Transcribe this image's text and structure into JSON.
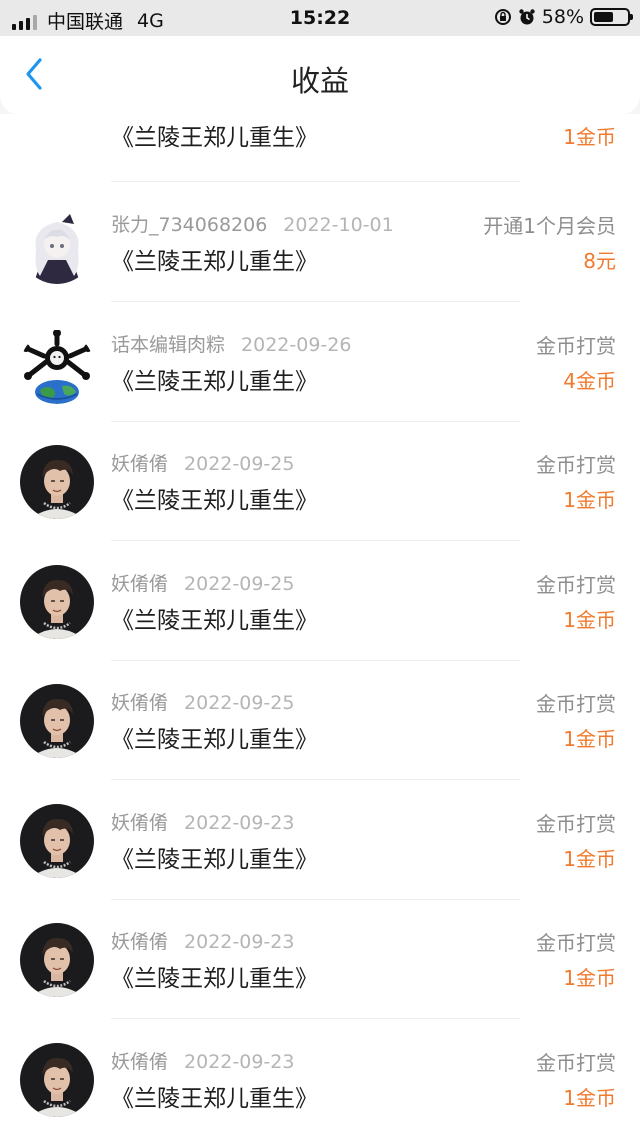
{
  "status_bar": {
    "carrier": "中国联通",
    "network": "4G",
    "time": "15:22",
    "battery": "58%",
    "battery_level": 0.58
  },
  "nav": {
    "title": "收益"
  },
  "colors": {
    "accent": "#f07a2e",
    "back": "#1e96f0"
  },
  "records": [
    {
      "user": "",
      "date": "",
      "title": "《兰陵王郑儿重生》",
      "type": "",
      "amount": "1金币",
      "avatar": "boy-portrait"
    },
    {
      "user": "张力_734068206",
      "date": "2022-10-01",
      "title": "《兰陵王郑儿重生》",
      "type": "开通1个月会员",
      "amount": "8元",
      "avatar": "anime-girl"
    },
    {
      "user": "话本编辑肉粽",
      "date": "2022-09-26",
      "title": "《兰陵王郑儿重生》",
      "type": "金币打赏",
      "amount": "4金币",
      "avatar": "globe-bones"
    },
    {
      "user": "妖倄倄",
      "date": "2022-09-25",
      "title": "《兰陵王郑儿重生》",
      "type": "金币打赏",
      "amount": "1金币",
      "avatar": "boy-portrait"
    },
    {
      "user": "妖倄倄",
      "date": "2022-09-25",
      "title": "《兰陵王郑儿重生》",
      "type": "金币打赏",
      "amount": "1金币",
      "avatar": "boy-portrait"
    },
    {
      "user": "妖倄倄",
      "date": "2022-09-25",
      "title": "《兰陵王郑儿重生》",
      "type": "金币打赏",
      "amount": "1金币",
      "avatar": "boy-portrait"
    },
    {
      "user": "妖倄倄",
      "date": "2022-09-23",
      "title": "《兰陵王郑儿重生》",
      "type": "金币打赏",
      "amount": "1金币",
      "avatar": "boy-portrait"
    },
    {
      "user": "妖倄倄",
      "date": "2022-09-23",
      "title": "《兰陵王郑儿重生》",
      "type": "金币打赏",
      "amount": "1金币",
      "avatar": "boy-portrait"
    },
    {
      "user": "妖倄倄",
      "date": "2022-09-23",
      "title": "《兰陵王郑儿重生》",
      "type": "金币打赏",
      "amount": "1金币",
      "avatar": "boy-portrait"
    }
  ]
}
